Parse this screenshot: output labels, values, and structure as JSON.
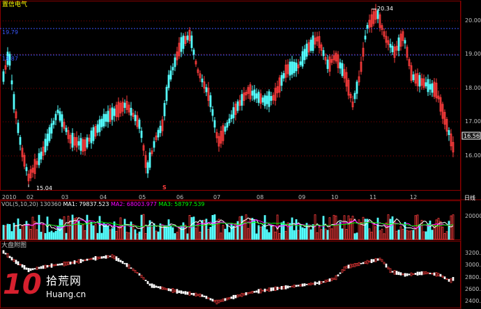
{
  "stock": {
    "name": "置信电气"
  },
  "price_axis": {
    "ticks": [
      "20.00",
      "19.00",
      "18.00",
      "17.00",
      "16.00"
    ],
    "current": "16.56"
  },
  "annotations": {
    "high": "20.34",
    "low": "15.04",
    "line_19_79": "19.79",
    "line_18_87": "18.87",
    "s_marker": "S"
  },
  "months": [
    "2010",
    "02",
    "03",
    "04",
    "05",
    "06",
    "07",
    "08",
    "09",
    "10",
    "11",
    "12"
  ],
  "period_label": "日线",
  "volume": {
    "header": "VOL(5,10,20)",
    "value": "130360",
    "ma1": "MA1: 79837.523",
    "ma2": "MA2: 68003.977",
    "ma3": "MA3: 58797.539",
    "axis_tick": "200000",
    "colors": {
      "ma1": "#ffffff",
      "ma2": "#ff00ff",
      "ma3": "#00ff00"
    }
  },
  "index_panel": {
    "title": "大盘附图",
    "ticks": [
      "3200.0",
      "3000.0",
      "2800.0",
      "2600.0",
      "2400.0"
    ]
  },
  "watermark": {
    "number": "10",
    "cn": "拾荒网",
    "en": "Huang.cn"
  },
  "colors": {
    "up": "#ff3d3d",
    "down": "#54ffff",
    "grid": "#8a0000",
    "dashed_level": "#3a58ff",
    "axis_text": "#c0c0c0"
  },
  "chart_data": {
    "type": "candlestick",
    "price_range": [
      15.0,
      20.4
    ],
    "high": 20.34,
    "low": 15.04,
    "levels": [
      19.79,
      18.87
    ],
    "index_range": [
      2350,
      3250
    ]
  }
}
